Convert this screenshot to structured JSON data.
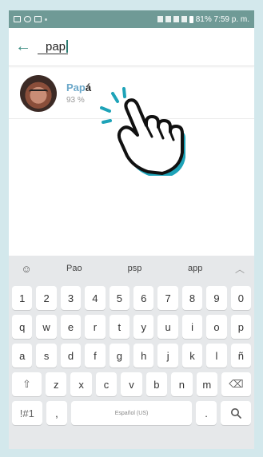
{
  "status_bar": {
    "right_text": "81% 7:59 p. m."
  },
  "search": {
    "query": "pap"
  },
  "result": {
    "name_highlight": "Pap",
    "name_rest": "á",
    "subtitle": "93 %"
  },
  "keyboard": {
    "suggestions": [
      "Pao",
      "psp",
      "app"
    ],
    "rows": [
      [
        "1",
        "2",
        "3",
        "4",
        "5",
        "6",
        "7",
        "8",
        "9",
        "0"
      ],
      [
        "q",
        "w",
        "e",
        "r",
        "t",
        "y",
        "u",
        "i",
        "o",
        "p"
      ],
      [
        "a",
        "s",
        "d",
        "f",
        "g",
        "h",
        "j",
        "k",
        "l",
        "ñ"
      ]
    ],
    "row4": {
      "shift_icon": "⇧",
      "letters": [
        "z",
        "x",
        "c",
        "v",
        "b",
        "n",
        "m"
      ],
      "backspace_icon": "⌫"
    },
    "row5": {
      "symbols": "!#1",
      "comma": ",",
      "space": "Español (US)",
      "period": ".",
      "search_icon": "🔍"
    }
  },
  "colors": {
    "accent": "#3b8c81",
    "status_bar": "#6f9a96",
    "highlight": "#6aa7c9",
    "frame": "#d3e8ec"
  }
}
